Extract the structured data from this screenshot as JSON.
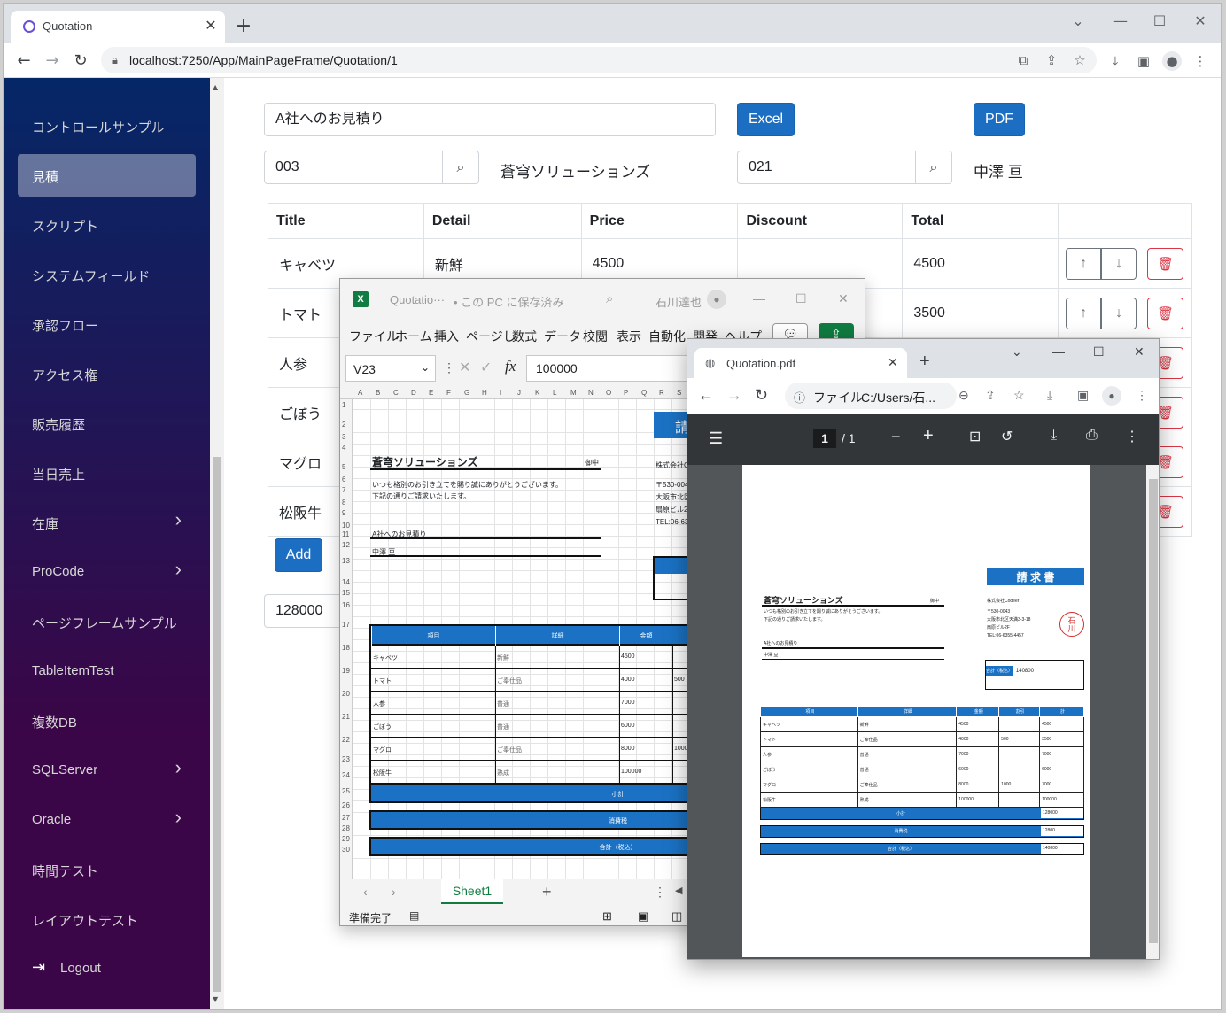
{
  "browser": {
    "tab_title": "Quotation",
    "url": "localhost:7250/App/MainPageFrame/Quotation/1"
  },
  "sidebar": {
    "items": [
      {
        "label": "コントロールサンプル",
        "has_chevron": false
      },
      {
        "label": "見積",
        "has_chevron": false,
        "active": true
      },
      {
        "label": "スクリプト",
        "has_chevron": false
      },
      {
        "label": "システムフィールド",
        "has_chevron": false
      },
      {
        "label": "承認フロー",
        "has_chevron": false
      },
      {
        "label": "アクセス権",
        "has_chevron": false
      },
      {
        "label": "販売履歴",
        "has_chevron": false
      },
      {
        "label": "当日売上",
        "has_chevron": false
      },
      {
        "label": "在庫",
        "has_chevron": true
      },
      {
        "label": "ProCode",
        "has_chevron": true
      },
      {
        "label": "ページフレームサンプル",
        "has_chevron": false
      },
      {
        "label": "TableItemTest",
        "has_chevron": false
      },
      {
        "label": "複数DB",
        "has_chevron": false
      },
      {
        "label": "SQLServer",
        "has_chevron": true
      },
      {
        "label": "Oracle",
        "has_chevron": true
      },
      {
        "label": "時間テスト",
        "has_chevron": false
      },
      {
        "label": "レイアウトテスト",
        "has_chevron": false
      }
    ],
    "logout_label": "Logout"
  },
  "form": {
    "title_value": "A社へのお見積り",
    "excel_label": "Excel",
    "pdf_label": "PDF",
    "customer_code": "003",
    "customer_name": "蒼穹ソリューションズ",
    "staff_code": "021",
    "staff_name": "中澤 亘",
    "add_label": "Add",
    "total_value": "128000"
  },
  "table": {
    "headers": [
      "Title",
      "Detail",
      "Price",
      "Discount",
      "Total"
    ],
    "rows": [
      {
        "title": "キャベツ",
        "detail": "新鮮",
        "price": "4500",
        "discount": "",
        "total": "4500"
      },
      {
        "title": "トマト",
        "detail": "",
        "price": "",
        "discount": "",
        "total": "3500"
      },
      {
        "title": "人参",
        "detail": "",
        "price": "",
        "discount": "",
        "total": ""
      },
      {
        "title": "ごぼう",
        "detail": "",
        "price": "",
        "discount": "",
        "total": ""
      },
      {
        "title": "マグロ",
        "detail": "",
        "price": "",
        "discount": "",
        "total": ""
      },
      {
        "title": "松阪牛",
        "detail": "",
        "price": "",
        "discount": "",
        "total": ""
      }
    ]
  },
  "excel": {
    "title": "Quotatio···",
    "save_status": "• この PC に保存済み",
    "user": "石川達也",
    "menus": [
      "ファイル",
      "ホーム",
      "挿入",
      "ページし",
      "数式",
      "データ",
      "校閲",
      "表示",
      "自動化",
      "開発",
      "ヘルプ"
    ],
    "cell_ref": "V23",
    "formula": "100000",
    "columns": [
      "A",
      "B",
      "C",
      "D",
      "E",
      "F",
      "G",
      "H",
      "I",
      "J",
      "K",
      "L",
      "M",
      "N",
      "O",
      "P",
      "Q",
      "R",
      "S"
    ],
    "rows": [
      "1",
      "2",
      "3",
      "4",
      "5",
      "6",
      "7",
      "8",
      "9",
      "10",
      "11",
      "12",
      "13",
      "14",
      "15",
      "16",
      "17",
      "18",
      "19",
      "20",
      "21",
      "22",
      "23",
      "24",
      "25",
      "26",
      "27",
      "28",
      "29",
      "30"
    ],
    "company": "蒼穹ソリューションズ",
    "onchu": "御中",
    "greeting1": "いつも格別のお引き立てを賜り誠にありがとうございます。",
    "greeting2": "下記の通りご請求いたします。",
    "subject": "A社へのお見積り",
    "staff": "中澤 亘",
    "seller_block": [
      "株式会社C",
      "〒530-004",
      "大阪市北区",
      "扇原ビル2",
      "TEL:06-63"
    ],
    "header_partial": "請",
    "table_headers": [
      "項目",
      "詳細",
      "金額"
    ],
    "table_rows": [
      [
        "キャベツ",
        "新鮮",
        "4500",
        ""
      ],
      [
        "トマト",
        "ご奉仕品",
        "4000",
        "500"
      ],
      [
        "人参",
        "普通",
        "7000",
        ""
      ],
      [
        "ごぼう",
        "普通",
        "6000",
        ""
      ],
      [
        "マグロ",
        "ご奉仕品",
        "8000",
        "1000"
      ],
      [
        "松阪牛",
        "熟成",
        "100000",
        ""
      ]
    ],
    "subtotal_label": "小計",
    "tax_label": "消費税",
    "total_label": "合計（税込）",
    "sheet_tab": "Sheet1",
    "status": "準備完了"
  },
  "pdf": {
    "tab_title": "Quotation.pdf",
    "url_prefix": "ファイル",
    "url": "C:/Users/石...",
    "page_current": "1",
    "page_total": "/ 1",
    "doc_title": "請 求 書",
    "company": "蒼穹ソリューションズ",
    "onchu": "御中",
    "greeting1": "いつも格別のお引き立てを賜り誠にありがとうございます。",
    "greeting2": "下記の通りご請求いたします。",
    "subject": "A社へのお見積り",
    "staff": "中澤 亘",
    "seller": [
      "株式会社Codeer",
      "〒530-0043",
      "大阪市北区天満3-3-18",
      "扇原ビル2F",
      "TEL:06-6355-4457"
    ],
    "stamp": "石川",
    "total_box_label": "合計（税込）",
    "total_box_value": "140800",
    "table_headers": [
      "項目",
      "詳細",
      "金額",
      "割引",
      "計"
    ],
    "table_rows": [
      [
        "キャベツ",
        "新鮮",
        "4500",
        "",
        "4500"
      ],
      [
        "トマト",
        "ご奉仕品",
        "4000",
        "500",
        "3500"
      ],
      [
        "人参",
        "普通",
        "7000",
        "",
        "7000"
      ],
      [
        "ごぼう",
        "普通",
        "6000",
        "",
        "6000"
      ],
      [
        "マグロ",
        "ご奉仕品",
        "8000",
        "1000",
        "7000"
      ],
      [
        "松阪牛",
        "熟成",
        "100000",
        "",
        "100000"
      ]
    ],
    "subtotal_label": "小計",
    "subtotal_value": "128000",
    "tax_label": "消費税",
    "tax_value": "12800",
    "total_label": "合計（税込）",
    "total_value": "140800"
  },
  "colors": {
    "primary": "#1b6ec2",
    "danger": "#dc3545",
    "sidebar_top": "#052767",
    "sidebar_bottom": "#3a0647",
    "doc_blue": "#1b72c4",
    "excel_green": "#107c41"
  }
}
